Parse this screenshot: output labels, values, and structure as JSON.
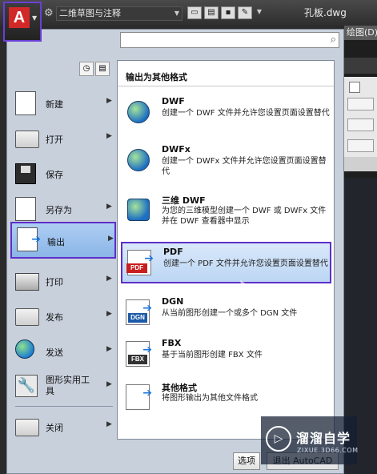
{
  "titlebar": {
    "app_logo": "A",
    "workspace": "二维草图与注释",
    "doc_title": "孔板.dwg",
    "drawing_tab": "绘图(D)"
  },
  "search": {
    "placeholder": ""
  },
  "left_menu": {
    "items": [
      {
        "label": "新建",
        "icon": "new-doc-icon"
      },
      {
        "label": "打开",
        "icon": "open-folder-icon"
      },
      {
        "label": "保存",
        "icon": "floppy-save-icon"
      },
      {
        "label": "另存为",
        "icon": "save-as-icon"
      },
      {
        "label": "输出",
        "icon": "export-icon"
      },
      {
        "label": "打印",
        "icon": "printer-icon"
      },
      {
        "label": "发布",
        "icon": "publish-icon"
      },
      {
        "label": "发送",
        "icon": "send-globe-icon"
      },
      {
        "label": "图形实用工具",
        "label_line1": "图形实用工",
        "label_line2": "具",
        "icon": "drawing-utilities-icon"
      },
      {
        "label": "关闭",
        "icon": "close-folder-icon"
      }
    ]
  },
  "submenu": {
    "title": "输出为其他格式",
    "items": [
      {
        "title": "DWF",
        "desc": "创建一个 DWF 文件并允许您设置页面设置替代"
      },
      {
        "title": "DWFx",
        "desc": "创建一个 DWFx 文件并允许您设置页面设置替代"
      },
      {
        "title": "三维 DWF",
        "desc": "为您的三维模型创建一个 DWF 或 DWFx 文件并在 DWF 查看器中显示"
      },
      {
        "title": "PDF",
        "desc": "创建一个 PDF 文件并允许您设置页面设置替代",
        "tag": "PDF"
      },
      {
        "title": "DGN",
        "desc": "从当前图形创建一个或多个 DGN 文件",
        "tag": "DGN"
      },
      {
        "title": "FBX",
        "desc": "基于当前图形创建 FBX 文件",
        "tag": "FBX"
      },
      {
        "title": "其他格式",
        "desc": "将图形输出为其他文件格式"
      }
    ]
  },
  "bottom_buttons": {
    "options": "选项",
    "exit": "退出 AutoCAD"
  },
  "watermark": {
    "cn": "溜溜自学",
    "en": "ZIXUE.3D66.COM"
  },
  "colors": {
    "highlight_border": "#5d2fc9",
    "menu_bg": "#c8d0dc",
    "app_red": "#d32828"
  }
}
